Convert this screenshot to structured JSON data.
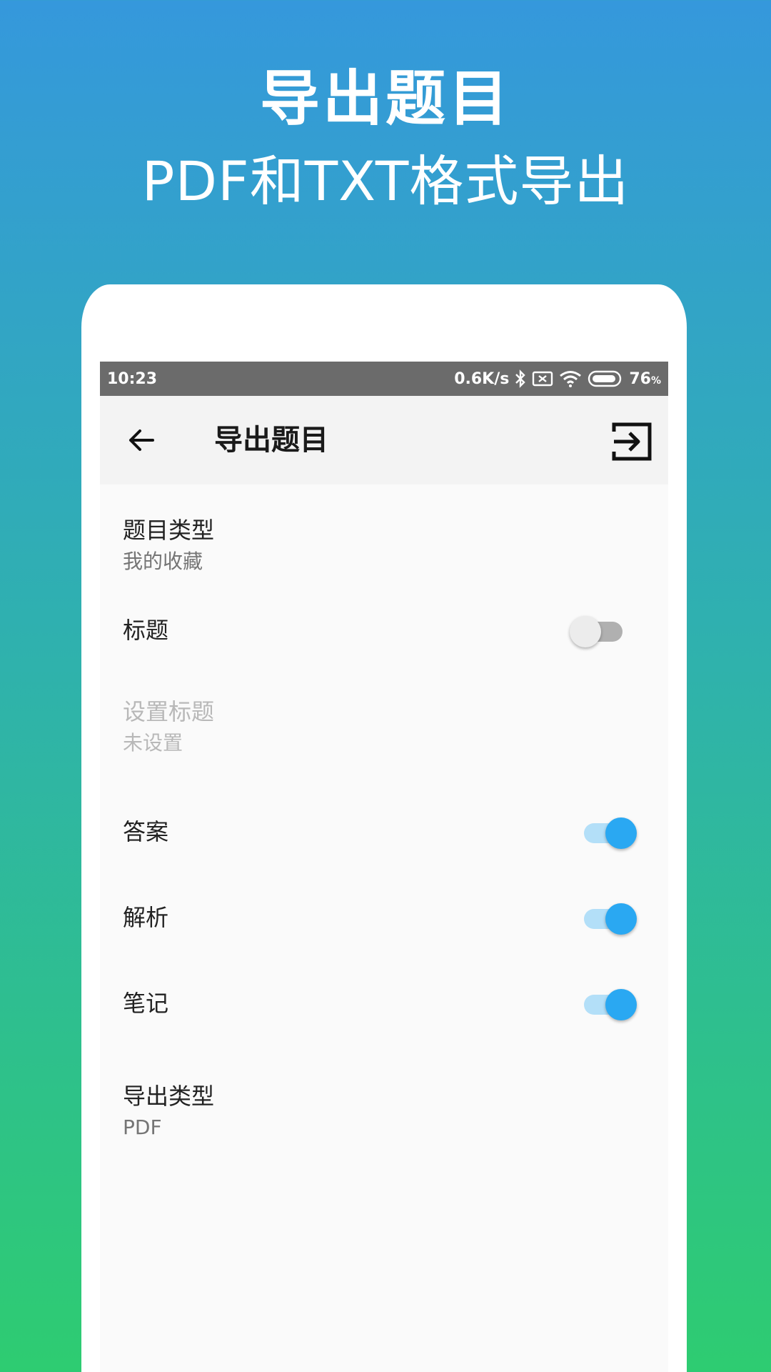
{
  "promo": {
    "title": "导出题目",
    "subtitle": "PDF和TXT格式导出"
  },
  "status_bar": {
    "time": "10:23",
    "speed": "0.6K/s",
    "battery": "76",
    "battery_unit": "%",
    "icons": [
      "bluetooth-icon",
      "sim-none-icon",
      "wifi-icon",
      "battery-icon"
    ]
  },
  "app_bar": {
    "back_icon": "arrow-left-icon",
    "title": "导出题目",
    "action_icon": "export-icon"
  },
  "settings": {
    "question_type": {
      "title": "题目类型",
      "value": "我的收藏"
    },
    "heading": {
      "title": "标题",
      "enabled": false
    },
    "set_heading": {
      "title": "设置标题",
      "value": "未设置",
      "disabled": true
    },
    "answer": {
      "title": "答案",
      "enabled": true
    },
    "analysis": {
      "title": "解析",
      "enabled": true
    },
    "notes": {
      "title": "笔记",
      "enabled": true
    },
    "export_type": {
      "title": "导出类型",
      "value": "PDF"
    }
  },
  "colors": {
    "gradient_top": "#3598dc",
    "gradient_bottom": "#2ecc71",
    "toggle_on": "#2aa8f2",
    "toggle_on_track": "#b3dff8",
    "status_bar": "#6b6b6b"
  }
}
